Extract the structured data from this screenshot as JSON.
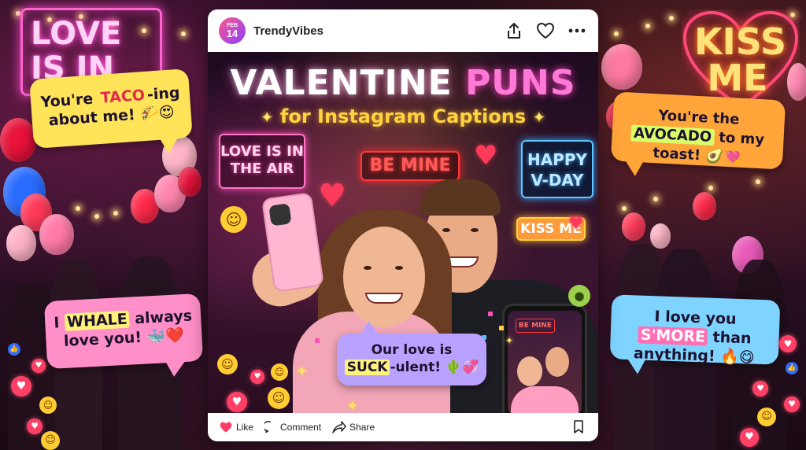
{
  "post": {
    "avatar_month": "FEB",
    "avatar_day": "14",
    "username": "TrendyVibes",
    "title_part1": "VALENTINE",
    "title_part2": "PUNS",
    "subtitle": "for Instagram Captions",
    "signs": {
      "love_air": "LOVE IS IN THE AIR",
      "be_mine": "BE MINE",
      "happy_vday": "HAPPY V-DAY",
      "kiss_me": "KISS ME",
      "phone_be_mine": "BE MINE"
    },
    "caption_bubble": {
      "line1": "Our love is",
      "highlight": "SUCK",
      "line2_rest": "-ulent!",
      "emoji": "🌵💞"
    },
    "footer": {
      "like_label": "Like",
      "comment_label": "Comment",
      "share_label": "Share"
    }
  },
  "background": {
    "neon_left": "LOVE IS IN THE AIR",
    "neon_right": "KISS ME"
  },
  "bubbles": [
    {
      "pre": "You're ",
      "highlight": "TACO",
      "post": "-ing about me!",
      "emoji": "🌮😍"
    },
    {
      "pre": "You're the ",
      "highlight": "AVOCADO",
      "post": " to my toast!",
      "emoji": "🥑💘"
    },
    {
      "pre": "I ",
      "highlight": "WHALE",
      "post": " always love you!",
      "emoji": "🐳❤️"
    },
    {
      "pre": "I love you ",
      "highlight": "S'MORE",
      "post": " than anything!",
      "emoji": "🔥😋"
    }
  ],
  "colors": {
    "like_heart": "#ff3f66",
    "accent_pink": "#ff79d6",
    "accent_yellow": "#ffd23f"
  },
  "icons": [
    "share-icon",
    "heart-icon",
    "more-icon",
    "comment-icon",
    "send-icon",
    "bookmark-icon"
  ]
}
